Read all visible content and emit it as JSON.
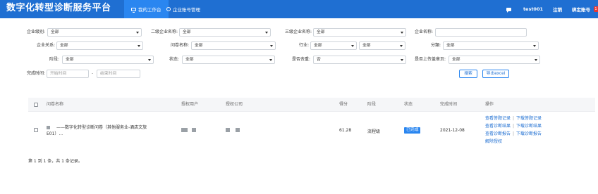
{
  "header": {
    "title": "数字化转型诊断服务平台",
    "tabs": [
      {
        "label": "我的工作台",
        "icon": "monitor-icon",
        "active": true
      },
      {
        "label": "企业账号管理",
        "icon": "user-icon",
        "active": false
      }
    ],
    "username": "test001",
    "logout": "注销",
    "bind_account": "绑定账号",
    "badge": "1"
  },
  "filters": {
    "enterprise_level": {
      "label": "企业级别:",
      "value": "全部"
    },
    "second_enterprise": {
      "label": "二级企业名称:",
      "value": "全部"
    },
    "third_enterprise": {
      "label": "三级企业名称:",
      "value": "全部"
    },
    "enterprise_name": {
      "label": "企业名称:",
      "value": ""
    },
    "enterprise_relation": {
      "label": "企业关系:",
      "value": "全部"
    },
    "questionnaire_name": {
      "label": "问卷名称:",
      "value": "全部"
    },
    "industry": {
      "label": "行业:",
      "value1": "全部",
      "value2": "全部"
    },
    "category": {
      "label": "分類:",
      "value": "全部"
    },
    "stage": {
      "label": "阶段:",
      "value": "全部"
    },
    "status": {
      "label": "状态:",
      "value": "全部"
    },
    "archived": {
      "label": "是否去重:",
      "value": "否"
    },
    "uploaded": {
      "label": "是否上传盖章页:",
      "value": "全部"
    },
    "completion_time": {
      "label": "完成时间:",
      "start_placeholder": "开始时间",
      "end_placeholder": "结束时间",
      "separator": "-"
    },
    "search_button": "搜索",
    "export_button": "导出excel"
  },
  "table": {
    "headers": [
      "问卷名称",
      "授权用户",
      "授权公司",
      "得分",
      "阶段",
      "状态",
      "完成时间",
      "操作"
    ],
    "rows": [
      {
        "name_line1": "——数字化转型诊断问卷（其他服务业-酒店文旅",
        "name_line2": "E01）...",
        "score": "61.28",
        "stage": "流程级",
        "status": "已完成",
        "completion_time": "2021-12-08",
        "operations": [
          [
            "查看答题记录",
            "下载答题记录"
          ],
          [
            "查看诊断结果",
            "下载诊断结果"
          ],
          [
            "查看诊断报告",
            "下载诊断报告"
          ],
          [
            "解除授权"
          ]
        ]
      }
    ]
  },
  "footer": {
    "summary": "第 1 到 1 条，共 1 条记录。"
  },
  "colors": {
    "header_bg": "#1f6fd2",
    "active_tab": "#2a86f0",
    "link": "#1f6fd2",
    "status_done": "#2a86f0"
  }
}
